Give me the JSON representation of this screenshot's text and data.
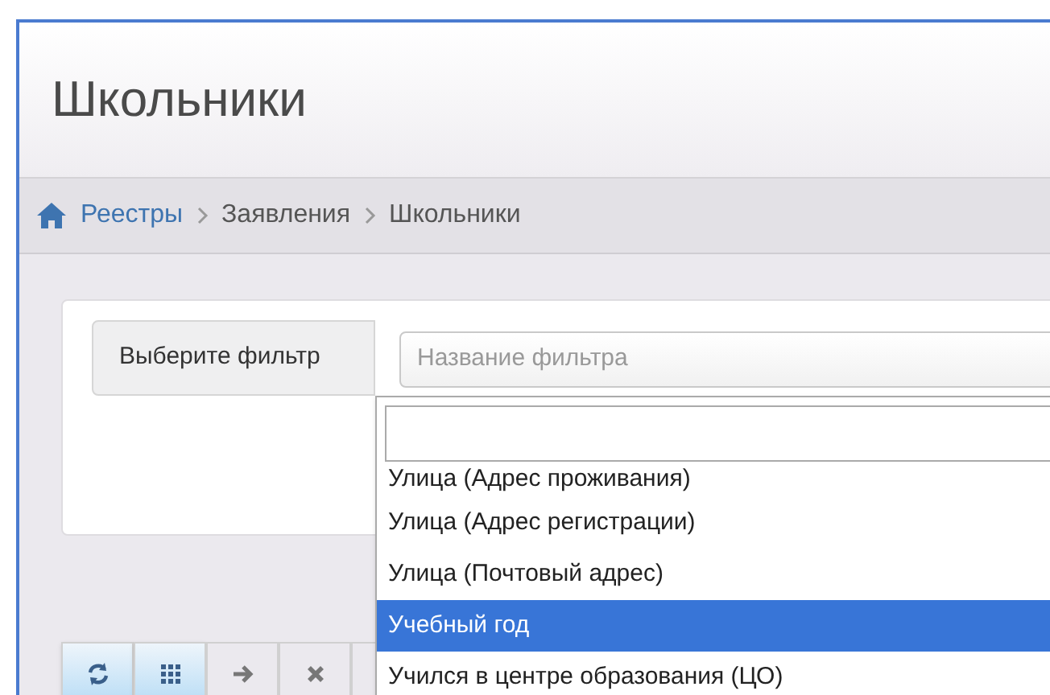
{
  "page_title": "Школьники",
  "breadcrumb": [
    {
      "label": "Реестры",
      "kind": "link"
    },
    {
      "label": "Заявления",
      "kind": "text"
    },
    {
      "label": "Школьники",
      "kind": "text"
    }
  ],
  "filter": {
    "label": "Выберите фильтр",
    "placeholder": "Название фильтра",
    "options": [
      {
        "label": "Улица (Адрес проживания)",
        "selected": false
      },
      {
        "label": "Улица (Адрес регистрации)",
        "selected": false
      },
      {
        "label": "Улица (Почтовый адрес)",
        "selected": false
      },
      {
        "label": "Учебный год",
        "selected": true
      },
      {
        "label": "Учился в центре образования (ЦО)",
        "selected": false
      }
    ]
  },
  "toolbar": [
    {
      "kind": "refresh",
      "selected": true
    },
    {
      "kind": "grid",
      "selected": true
    },
    {
      "kind": "arrow",
      "selected": false
    },
    {
      "kind": "close",
      "selected": false
    },
    {
      "kind": "blank",
      "selected": false
    }
  ]
}
